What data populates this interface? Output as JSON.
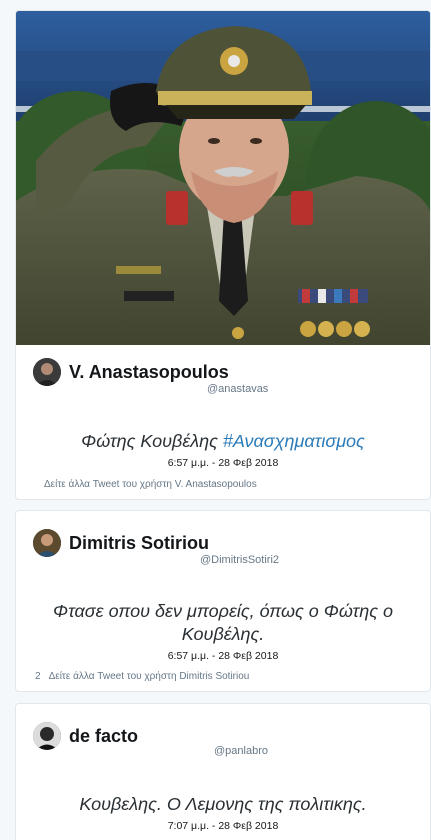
{
  "tweets": [
    {
      "name": "V. Anastasopoulos",
      "handle": "@anastavas",
      "text": "Φώτης Κουβέλης ",
      "hashtag": "#Ανασχηματισμος",
      "time": "6:57 μ.μ. - 28 Φεβ 2018",
      "more": "Δείτε άλλα Tweet του χρήστη V. Anastasopoulos",
      "avatar_icon": "user-avatar-icon"
    },
    {
      "name": "Dimitris Sotiriou",
      "handle": "@DimitrisSotiri2",
      "text_line1": "Φτασε οπου δεν μπορείς, όπως ο Φώτης ο",
      "text_line2": "Κουβέλης.",
      "time": "6:57 μ.μ. - 28 Φεβ 2018",
      "count": "2",
      "more": "Δείτε άλλα Tweet του χρήστη Dimitris Sotiriou",
      "avatar_icon": "user-avatar-icon"
    },
    {
      "name": "de facto",
      "handle": "@panlabro",
      "text": "Κουβελης. Ο Λεμονης της πολιτικης.",
      "time": "7:07 μ.μ. - 28 Φεβ 2018",
      "avatar_icon": "user-avatar-icon"
    }
  ],
  "photo": {
    "subject": "military-officer-saluting-photo"
  },
  "colors": {
    "hashtag": "#2b7bb9",
    "muted": "#657786",
    "border": "#e1e8ed"
  }
}
